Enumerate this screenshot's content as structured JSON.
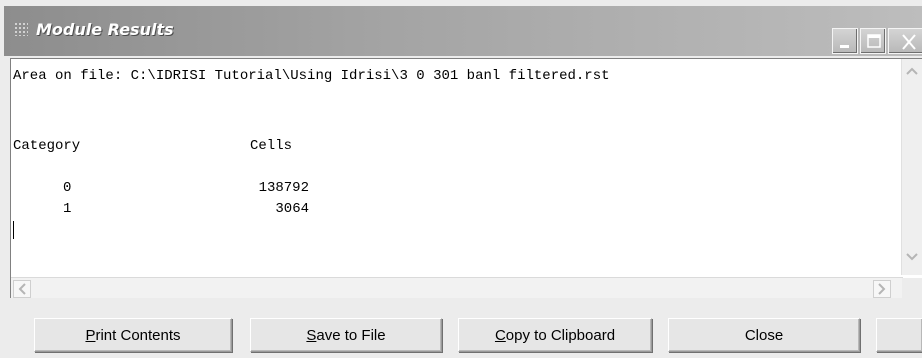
{
  "window": {
    "title": "Module Results",
    "controls": [
      "minimize-icon",
      "maximize-icon",
      "close-icon"
    ]
  },
  "output": {
    "area_line": "Area on file: C:\\IDRISI Tutorial\\Using Idrisi\\3 0 301 banl filtered.rst",
    "headers": {
      "category": "Category",
      "cells": "Cells"
    },
    "rows": [
      {
        "category": "0",
        "cells": "138792"
      },
      {
        "category": "1",
        "cells": "3064"
      }
    ]
  },
  "buttons": {
    "print": {
      "accel": "P",
      "rest": "rint Contents"
    },
    "save": {
      "accel": "S",
      "rest": "ave to File"
    },
    "copy": {
      "accel": "C",
      "rest": "opy to Clipboard"
    },
    "close": "Close"
  }
}
